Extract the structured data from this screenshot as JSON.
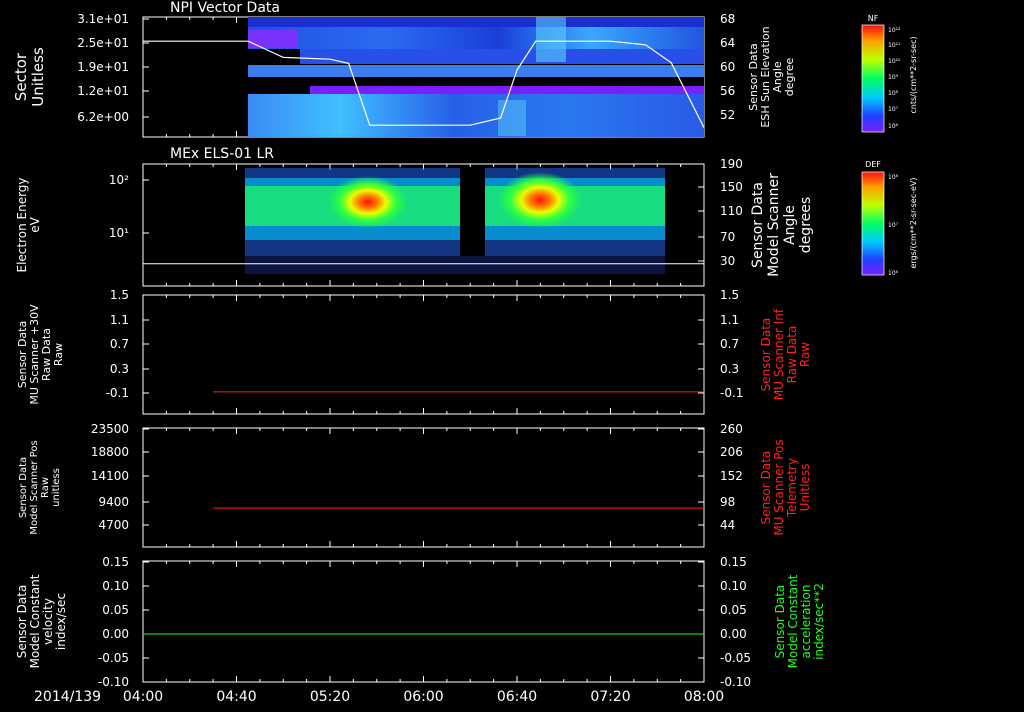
{
  "colors": {
    "background": "#000000",
    "frame": "#ffffff",
    "red_line": "#ff2020",
    "green_line": "#20ff20",
    "red_label": "#ff2020",
    "green_label": "#20ff20"
  },
  "time_axis": {
    "date_label": "2014/139",
    "ticks": [
      "04:00",
      "04:40",
      "05:20",
      "06:00",
      "06:40",
      "07:20",
      "08:00"
    ]
  },
  "panels": [
    {
      "id": "npi",
      "title": "NPI Vector Data",
      "left_label": [
        "Sector",
        "Unitless"
      ],
      "left_ticks": [
        "3.1e+01",
        "2.5e+01",
        "1.9e+01",
        "1.2e+01",
        "6.2e+00"
      ],
      "right_ticks": [
        "68",
        "64",
        "60",
        "56",
        "52"
      ],
      "right_label": [
        "Sensor Data",
        "ESH Sun Elevation",
        "Angle",
        "degree"
      ],
      "colorbar_title": "NF",
      "colorbar_ticks": [
        "10¹²",
        "10¹¹",
        "10¹⁰",
        "10⁹",
        "10⁸",
        "10⁷",
        "10⁶"
      ],
      "colorbar_unit": "cnts/(cm**2-sr-sec)"
    },
    {
      "id": "els",
      "title": "MEx ELS-01 LR",
      "left_label": [
        "Electron Energy",
        "eV"
      ],
      "left_ticks": [
        "10²",
        "10¹"
      ],
      "right_ticks": [
        "190",
        "150",
        "110",
        "70",
        "30"
      ],
      "right_label": [
        "Sensor Data",
        "Model Scanner",
        "Angle",
        "degrees"
      ],
      "colorbar_title": "DEF",
      "colorbar_ticks": [
        "10⁸",
        "10⁷",
        "10⁶"
      ],
      "colorbar_unit": "ergs/(cm**2-sr-sec-eV)"
    },
    {
      "id": "mu30",
      "left_label": [
        "Sensor Data",
        "MU Scanner +30V",
        "Raw Data",
        "Raw"
      ],
      "left_ticks": [
        "1.5",
        "1.1",
        "0.7",
        "0.3",
        "-0.1"
      ],
      "right_ticks": [
        "1.5",
        "1.1",
        "0.7",
        "0.3",
        "-0.1"
      ],
      "right_label": [
        "Sensor Data",
        "MU Scanner Inf",
        "Raw Data",
        "Raw"
      ]
    },
    {
      "id": "scanpos",
      "left_label": [
        "Sensor Data",
        "Model Scanner Pos",
        "Raw",
        "unitless"
      ],
      "left_ticks": [
        "23500",
        "18800",
        "14100",
        "9400",
        "4700"
      ],
      "right_ticks": [
        "260",
        "206",
        "152",
        "98",
        "44"
      ],
      "right_label": [
        "Sensor Data",
        "MU Scanner Pos",
        "Telemetry",
        "Unitless"
      ]
    },
    {
      "id": "const",
      "left_label": [
        "Sensor Data",
        "Model Constant",
        "velocity",
        "index/sec"
      ],
      "left_ticks": [
        "0.15",
        "0.10",
        "0.05",
        "0.00",
        "-0.05",
        "-0.10"
      ],
      "right_ticks": [
        "0.15",
        "0.10",
        "0.05",
        "0.00",
        "-0.05",
        "-0.10"
      ],
      "right_label": [
        "Sensor Data",
        "Model Constant",
        "acceleration",
        "index/sec**2"
      ]
    }
  ],
  "chart_data": [
    {
      "type": "heatmap",
      "title": "NPI Vector Data",
      "x_range": [
        "04:00",
        "08:00"
      ],
      "data_start": "04:40",
      "ylabel": "Sector Unitless",
      "ylim": [
        0,
        31
      ],
      "colorbar": {
        "label": "NF",
        "range": [
          1000000.0,
          1000000000000.0
        ],
        "unit": "cnts/(cm**2-sr-sec)"
      },
      "overlay_line": {
        "name": "ESH Sun Elevation Angle",
        "unit": "degree",
        "x": [
          "04:00",
          "04:40",
          "04:45",
          "05:00",
          "05:20",
          "05:28",
          "05:37",
          "06:00",
          "06:20",
          "06:33",
          "06:40",
          "06:48",
          "07:20",
          "07:35",
          "07:46",
          "08:00"
        ],
        "y": [
          64.3,
          64.3,
          64.3,
          61.6,
          61.3,
          60.6,
          50.3,
          50.3,
          50.3,
          51.5,
          59.5,
          64.3,
          64.3,
          63.7,
          60.7,
          49.9
        ]
      }
    },
    {
      "type": "heatmap",
      "title": "MEx ELS-01 LR",
      "x_range": [
        "04:00",
        "08:00"
      ],
      "data_range": [
        "04:37",
        "07:28"
      ],
      "ylabel": "Electron Energy eV",
      "y_scale": "log",
      "colorbar": {
        "label": "DEF",
        "range": [
          1000000.0,
          100000000.0
        ],
        "unit": "ergs/(cm**2-sr-sec-eV)"
      },
      "overlay_line": {
        "name": "Model Scanner Angle",
        "unit": "degrees",
        "x": [
          "04:00",
          "08:00"
        ],
        "y": [
          22,
          22
        ]
      }
    },
    {
      "type": "line",
      "x_range": [
        "04:00",
        "08:00"
      ],
      "ylim": [
        -0.3,
        1.5
      ],
      "series": [
        {
          "name": "MU Scanner Inf Raw Data",
          "x": [
            "04:30",
            "08:00"
          ],
          "y": [
            -0.08,
            -0.08
          ],
          "color": "#ff2020"
        }
      ]
    },
    {
      "type": "line",
      "x_range": [
        "04:00",
        "08:00"
      ],
      "ylim": [
        0,
        23500
      ],
      "series": [
        {
          "name": "MU Scanner Pos Telemetry",
          "x": [
            "04:30",
            "08:00"
          ],
          "y": [
            8000,
            8000
          ],
          "color": "#ff2020"
        }
      ]
    },
    {
      "type": "line",
      "x_range": [
        "04:00",
        "08:00"
      ],
      "ylim": [
        -0.1,
        0.15
      ],
      "series": [
        {
          "name": "Model Constant acceleration",
          "x": [
            "04:00",
            "08:00"
          ],
          "y": [
            0.0,
            0.0
          ],
          "color": "#20ff20"
        }
      ]
    }
  ]
}
